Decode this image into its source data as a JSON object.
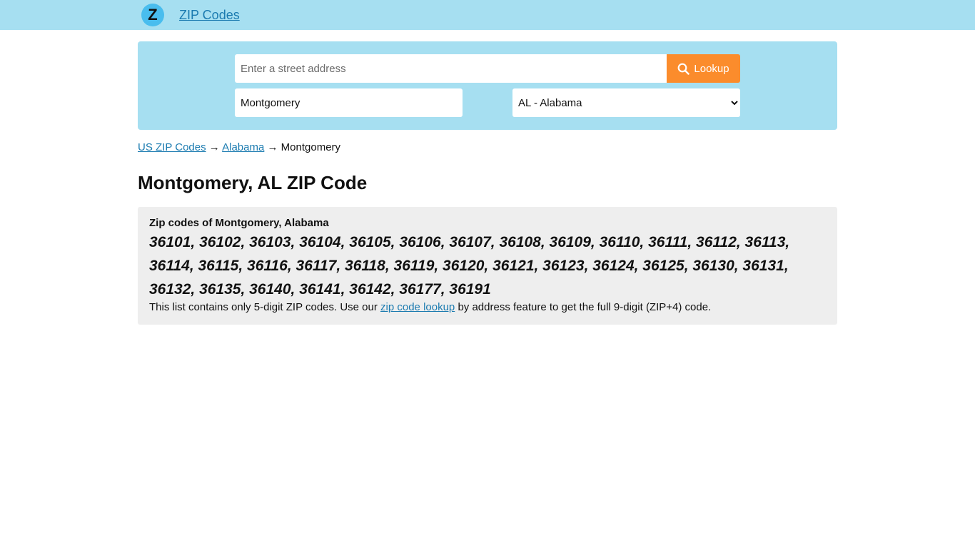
{
  "header": {
    "logo_letter": "Z",
    "brand_label": "ZIP Codes"
  },
  "search": {
    "address_placeholder": "Enter a street address",
    "address_value": "",
    "lookup_label": "Lookup",
    "city_value": "Montgomery",
    "state_selected": "AL - Alabama"
  },
  "breadcrumb": {
    "items": [
      "US ZIP Codes",
      "Alabama"
    ],
    "separator": "→",
    "current": "Montgomery"
  },
  "page_title": "Montgomery, AL ZIP Code",
  "zip_section": {
    "heading": "Zip codes of Montgomery, Alabama",
    "zip_codes": "36101, 36102, 36103, 36104, 36105, 36106, 36107, 36108, 36109, 36110, 36111, 36112, 36113, 36114, 36115, 36116, 36117, 36118, 36119, 36120, 36121, 36123, 36124, 36125, 36130, 36131, 36132, 36135, 36140, 36141, 36142, 36177, 36191",
    "note_before": "This list contains only 5-digit ZIP codes. Use our ",
    "note_link": "zip code lookup",
    "note_after": " by address feature to get the full 9-digit (ZIP+4) code."
  },
  "colors": {
    "header_bg": "#a6dff1",
    "logo_bg": "#49bdee",
    "link": "#1b7bb0",
    "lookup_button": "#fb8c2c",
    "zip_box_bg": "#eeeeee"
  },
  "icons": {
    "lookup": "search-icon"
  }
}
